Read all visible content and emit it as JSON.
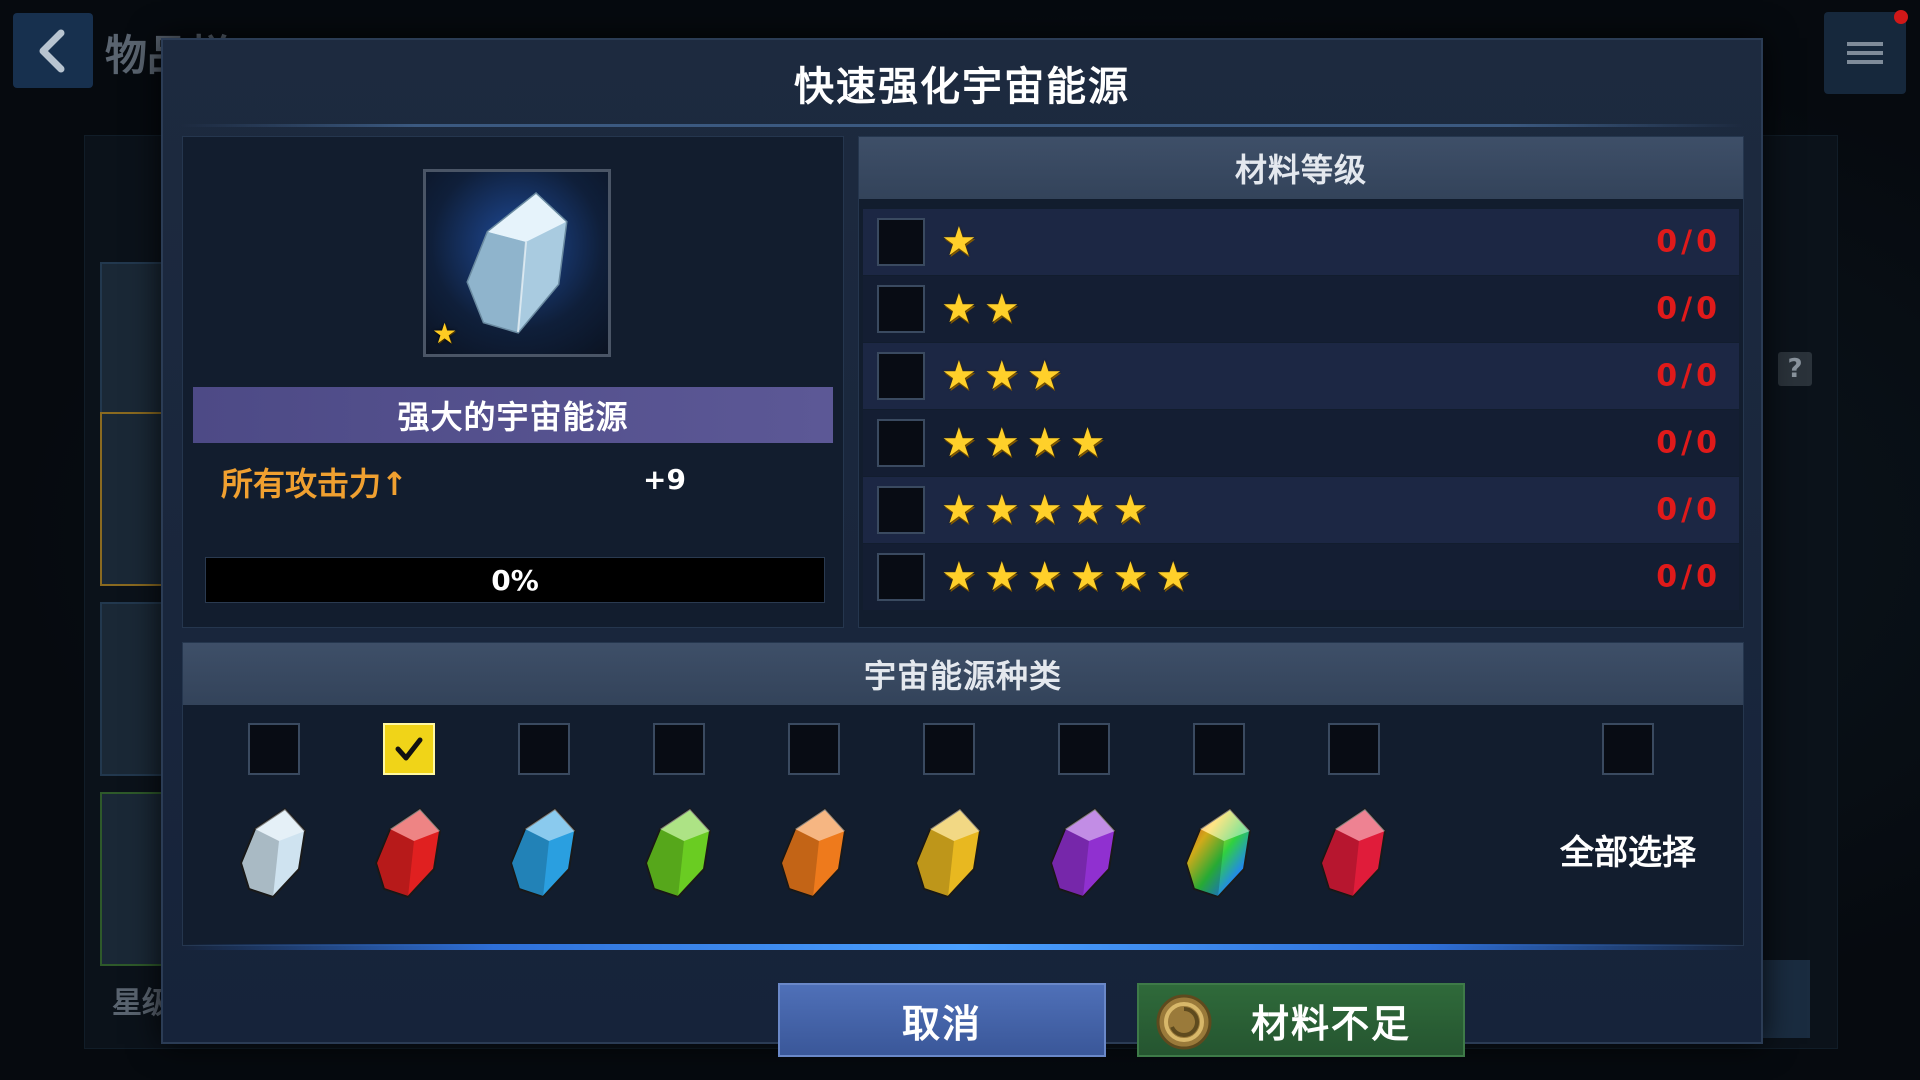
{
  "background": {
    "title": "物品栏",
    "star_label": "星级"
  },
  "dialog": {
    "title": "快速强化宇宙能源",
    "item": {
      "name": "强大的宇宙能源",
      "star_count": 1,
      "stat_label": "所有攻击力↑",
      "stat_value": "+9",
      "progress": 0,
      "progress_text": "0%"
    },
    "grade_section": {
      "header": "材料等级",
      "rows": [
        {
          "stars": 1,
          "count": "0/0",
          "checked": false
        },
        {
          "stars": 2,
          "count": "0/0",
          "checked": false
        },
        {
          "stars": 3,
          "count": "0/0",
          "checked": false
        },
        {
          "stars": 4,
          "count": "0/0",
          "checked": false
        },
        {
          "stars": 5,
          "count": "0/0",
          "checked": false
        },
        {
          "stars": 6,
          "count": "0/0",
          "checked": false
        }
      ]
    },
    "type_section": {
      "header": "宇宙能源种类",
      "types": [
        {
          "name": "crystal-icon",
          "color": "#cfe3f0",
          "checked": false
        },
        {
          "name": "red-crystal-icon",
          "color": "#e02020",
          "checked": true
        },
        {
          "name": "blue-crystal-icon",
          "color": "#2a9fe0",
          "checked": false
        },
        {
          "name": "green-crystal-icon",
          "color": "#6acc22",
          "checked": false
        },
        {
          "name": "orange-crystal-icon",
          "color": "#ee7a1c",
          "checked": false
        },
        {
          "name": "yellow-crystal-icon",
          "color": "#e8b820",
          "checked": false
        },
        {
          "name": "purple-crystal-icon",
          "color": "#9030d0",
          "checked": false
        },
        {
          "name": "rainbow-crystal-icon",
          "color": "#rainbow",
          "checked": false
        },
        {
          "name": "ruby-crystal-icon",
          "color": "#e01c3a",
          "checked": false
        }
      ],
      "select_all_label": "全部选择",
      "select_all_checked": false
    },
    "buttons": {
      "cancel": "取消",
      "insufficient": "材料不足"
    }
  }
}
